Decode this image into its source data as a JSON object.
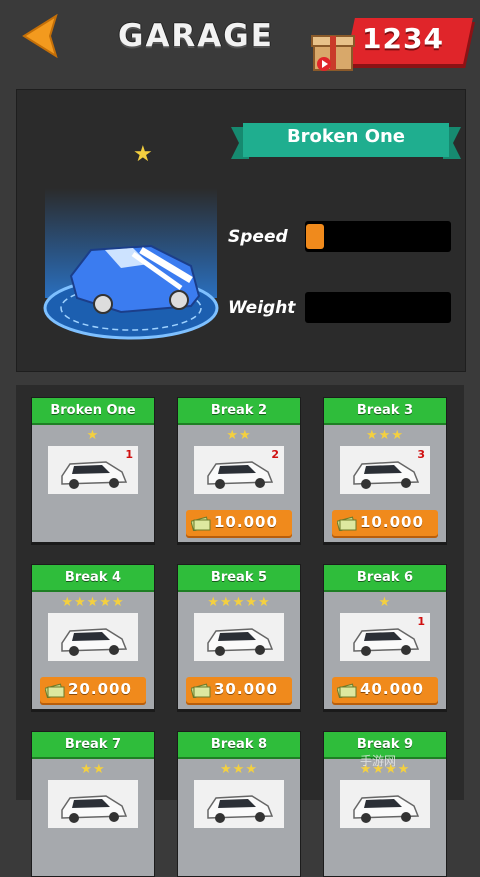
{
  "header": {
    "title": "GARAGE",
    "coins": "1234",
    "back_icon": "back-arrow-icon",
    "gift_icon": "gift-icon"
  },
  "selected_car": {
    "name": "Broken One",
    "stars": 1,
    "speed_label": "Speed",
    "weight_label": "Weight",
    "speed_level": 0.12,
    "weight_level": 0.0
  },
  "colors": {
    "accent_orange": "#f08a1c",
    "card_header_green": "#2fbd3b",
    "ribbon_teal": "#1fae8f",
    "coin_red": "#e0252a",
    "star_yellow": "#f4d03f"
  },
  "cars": [
    {
      "name": "Broken One",
      "stars": 1,
      "badge": "",
      "price": ""
    },
    {
      "name": "Break 2",
      "stars": 2,
      "badge": "2",
      "price": "10.000"
    },
    {
      "name": "Break 3",
      "stars": 3,
      "badge": "3",
      "price": "10.000"
    },
    {
      "name": "Break 4",
      "stars": 5,
      "badge": "",
      "price": "20.000"
    },
    {
      "name": "Break 5",
      "stars": 5,
      "badge": "",
      "price": "30.000"
    },
    {
      "name": "Break 6",
      "stars": 1,
      "badge": "1",
      "price": "40.000"
    },
    {
      "name": "Break 7",
      "stars": 2,
      "badge": "",
      "price": ""
    },
    {
      "name": "Break 8",
      "stars": 3,
      "badge": "",
      "price": ""
    },
    {
      "name": "Break 9",
      "stars": 4,
      "badge": "",
      "price": ""
    }
  ],
  "first_car_badge": "1",
  "watermark": "手游网"
}
